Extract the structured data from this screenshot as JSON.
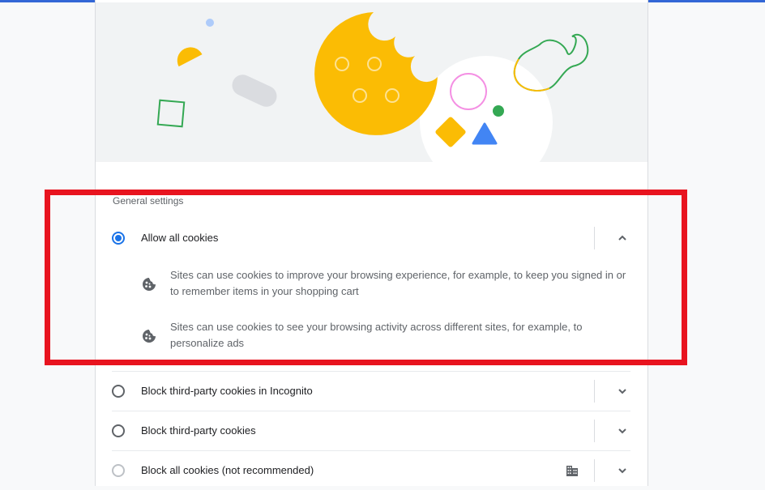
{
  "accent_color": "#1a73e8",
  "highlight_color": "#e8141f",
  "general_settings": {
    "title": "General settings",
    "options": [
      {
        "label": "Allow all cookies",
        "selected": true,
        "expanded": true,
        "chevron_icon": "chevron-up-icon",
        "details": [
          {
            "icon": "cookie-icon",
            "text": "Sites can use cookies to improve your browsing experience, for example, to keep you signed in or to remember items in your shopping cart"
          },
          {
            "icon": "cookie-icon",
            "text": "Sites can use cookies to see your browsing activity across different sites, for example, to personalize ads"
          }
        ]
      },
      {
        "label": "Block third-party cookies in Incognito",
        "selected": false,
        "expanded": false,
        "chevron_icon": "chevron-down-icon"
      },
      {
        "label": "Block third-party cookies",
        "selected": false,
        "expanded": false,
        "chevron_icon": "chevron-down-icon"
      },
      {
        "label": "Block all cookies (not recommended)",
        "selected": false,
        "disabled_look": true,
        "managed_icon": "building-icon",
        "expanded": false,
        "chevron_icon": "chevron-down-icon"
      }
    ]
  }
}
